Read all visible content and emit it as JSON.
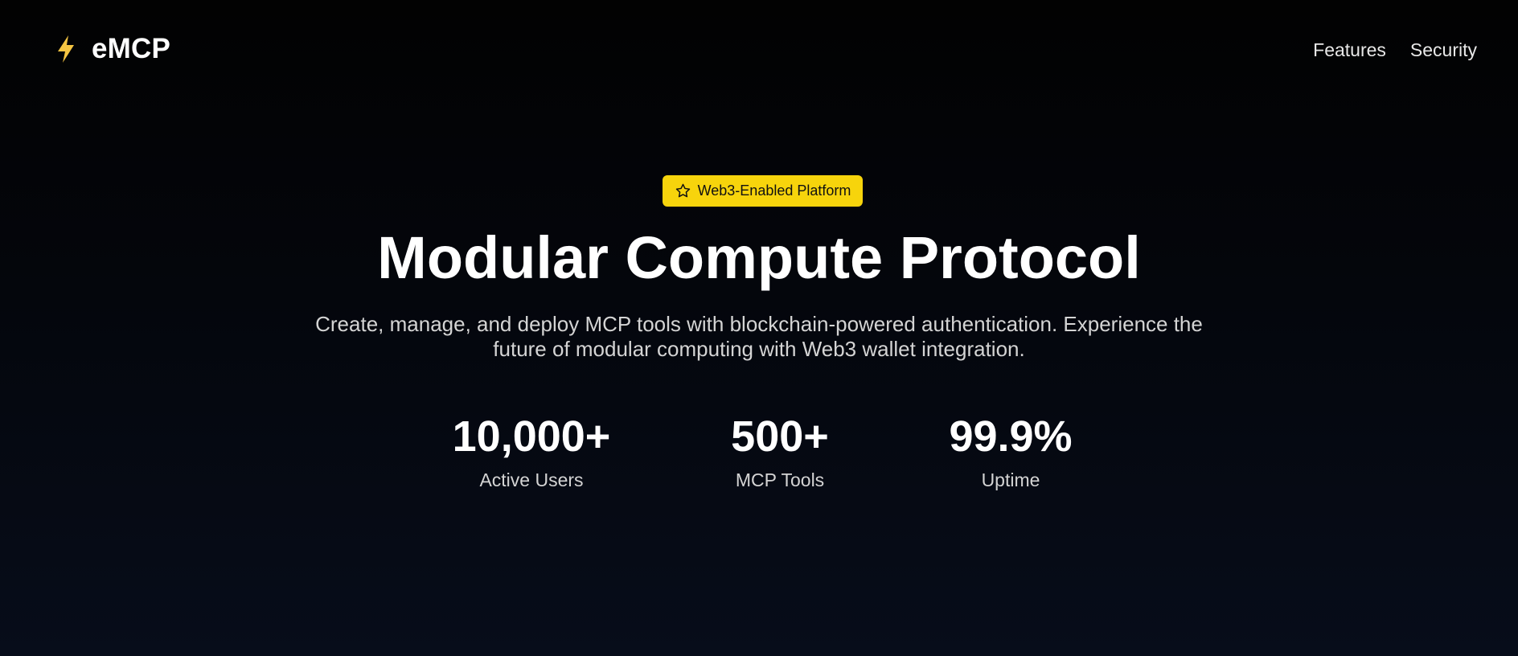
{
  "header": {
    "brand_name": "eMCP",
    "brand_icon": "lightning-bolt-icon",
    "nav": [
      {
        "label": "Features"
      },
      {
        "label": "Security"
      }
    ]
  },
  "hero": {
    "badge": {
      "icon": "star-icon",
      "label": "Web3-Enabled Platform"
    },
    "title": "Modular Compute Protocol",
    "description": "Create, manage, and deploy MCP tools with blockchain-powered authentication. Experience the future of modular computing with Web3 wallet integration."
  },
  "stats": [
    {
      "value": "10,000+",
      "label": "Active Users"
    },
    {
      "value": "500+",
      "label": "MCP Tools"
    },
    {
      "value": "99.9%",
      "label": "Uptime"
    }
  ],
  "colors": {
    "background_top": "#020202",
    "background_bottom": "#070d1a",
    "accent": "#f7d40c",
    "text_primary": "#ffffff",
    "text_secondary": "#d4d4d4"
  }
}
